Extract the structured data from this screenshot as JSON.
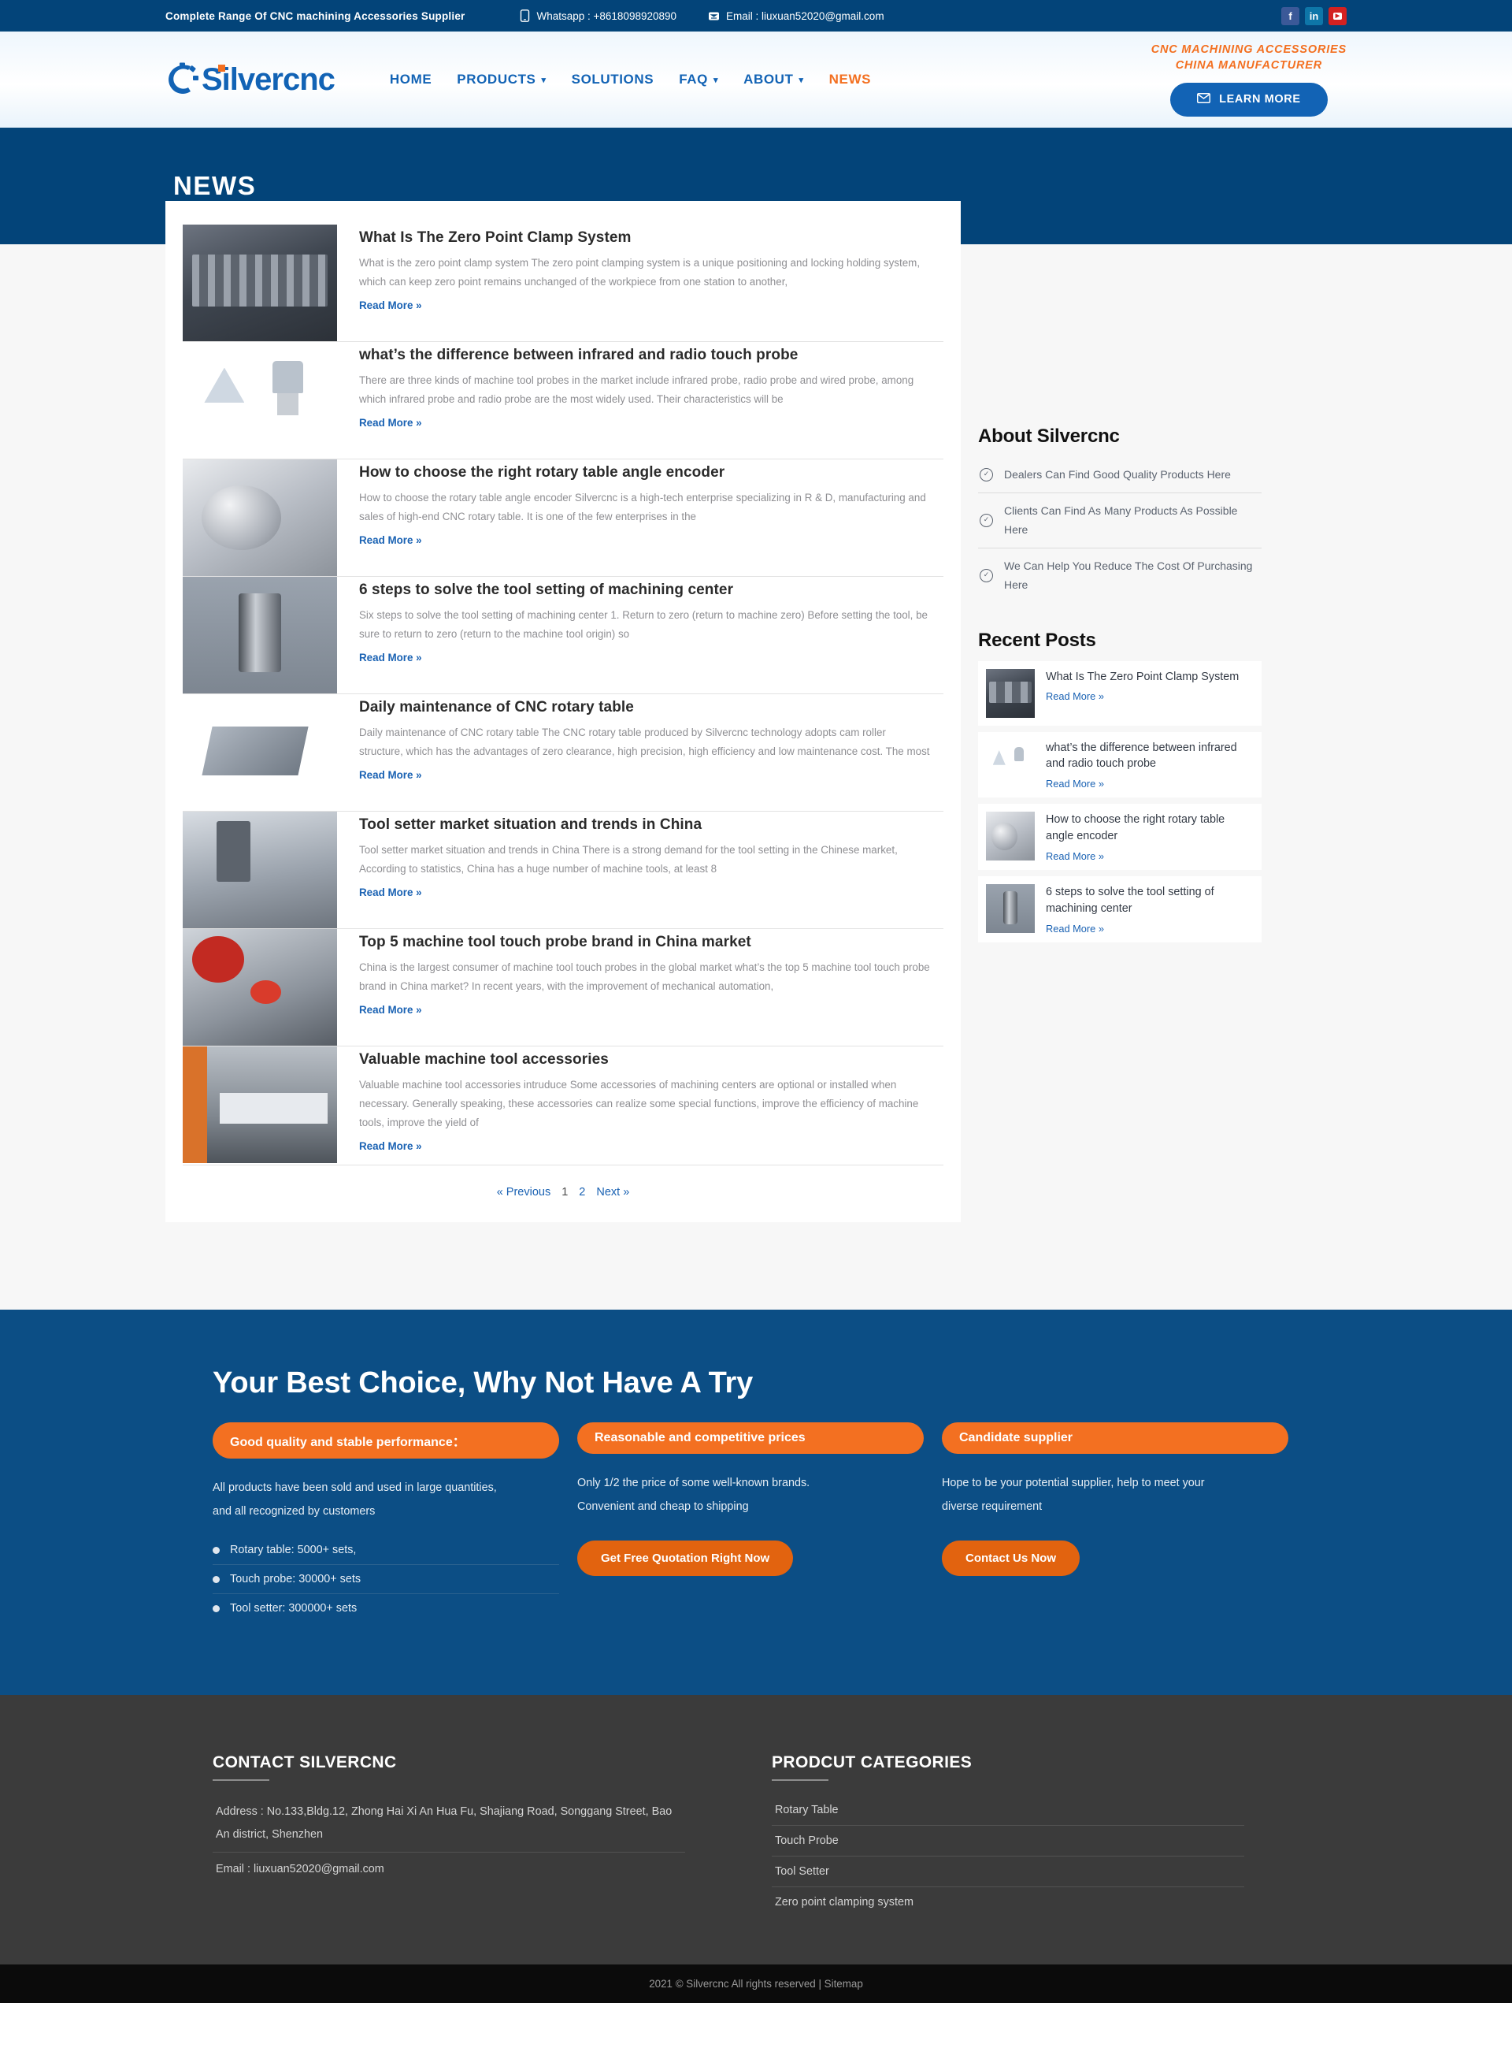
{
  "topbar": {
    "tagline": "Complete Range Of CNC machining Accessories Supplier",
    "whatsapp_icon": "phone-icon",
    "whatsapp_label": "Whatsapp :  +8618098920890",
    "email_icon": "envelope-icon",
    "email_label": "Email :  liuxuan52020@gmail.com",
    "socials": [
      {
        "name": "facebook-icon",
        "glyph": "f"
      },
      {
        "name": "linkedin-icon",
        "glyph": "in"
      },
      {
        "name": "youtube-icon",
        "glyph": "▶"
      }
    ]
  },
  "header": {
    "logo_text": "Silvercnc",
    "nav": [
      {
        "label": "HOME",
        "caret": "",
        "active": false
      },
      {
        "label": "PRODUCTS",
        "caret": "⌄",
        "active": false
      },
      {
        "label": "SOLUTIONS",
        "caret": "",
        "active": false
      },
      {
        "label": "FAQ",
        "caret": "⌄",
        "active": false
      },
      {
        "label": "ABOUT",
        "caret": "⌄",
        "active": false
      },
      {
        "label": "NEWS",
        "caret": "",
        "active": true
      }
    ],
    "tagline_line1": "CNC MACHINING ACCESSORIES",
    "tagline_line2": "CHINA MANUFACTURER",
    "cta_icon": "envelope-icon",
    "cta_label": "LEARN MORE"
  },
  "banner": {
    "title": "NEWS"
  },
  "posts": [
    {
      "title": "What Is The Zero Point Clamp System",
      "excerpt": "What is the zero point clamp system The zero point clamping system is a unique positioning and locking holding system, which can keep zero point remains unchanged of the workpiece from one station to another,",
      "read_more": "Read More »",
      "thumb": "t1"
    },
    {
      "title": "what’s the difference between infrared and radio touch probe",
      "excerpt": "There are three kinds of machine tool probes in the market include infrared probe, radio probe and wired probe, among which infrared probe and radio probe are the most widely used. Their characteristics will be",
      "read_more": "Read More »",
      "thumb": "t2"
    },
    {
      "title": "How to choose the right rotary table angle encoder",
      "excerpt": "How to choose the rotary table angle encoder Silvercnc  is a high-tech enterprise specializing in  R & D, manufacturing and sales of high-end CNC rotary table. It is one of the few enterprises in the",
      "read_more": "Read More »",
      "thumb": "t3"
    },
    {
      "title": "6 steps to solve the tool setting of machining center",
      "excerpt": "Six steps to solve the tool setting of machining center 1. Return to zero (return to machine zero) Before setting the tool, be sure to return to zero (return to the machine tool origin) so",
      "read_more": "Read More »",
      "thumb": "t4"
    },
    {
      "title": "Daily maintenance of CNC rotary table",
      "excerpt": "Daily maintenance of CNC rotary table The CNC rotary table produced by Silvercnc technology adopts cam roller structure, which has the advantages of zero clearance, high precision, high efficiency and low maintenance cost. The most",
      "read_more": "Read More »",
      "thumb": "t5"
    },
    {
      "title": "Tool setter market situation and trends in China",
      "excerpt": "Tool setter market situation and trends in China There is a strong demand for the tool setting  in the Chinese market, According to statistics, China has a huge number of machine tools, at least 8",
      "read_more": "Read More »",
      "thumb": "t6"
    },
    {
      "title": "Top 5 machine tool touch probe brand in China market",
      "excerpt": "China is the largest consumer of machine tool touch probes in the global market what’s the top 5 machine tool touch probe brand in China market? In recent years, with the improvement of mechanical automation,",
      "read_more": "Read More »",
      "thumb": "t7"
    },
    {
      "title": "Valuable machine tool accessories",
      "excerpt": "Valuable machine tool accessories intruduce Some accessories of machining centers are optional or installed when necessary. Generally speaking, these accessories can realize some special functions, improve the efficiency of machine tools, improve the yield of",
      "read_more": "Read More »",
      "thumb": "t8"
    }
  ],
  "pagination": {
    "previous": "« Previous",
    "pages": [
      "1",
      "2"
    ],
    "current": "1",
    "next": "Next »"
  },
  "sidebar": {
    "about_heading": "About Silvercnc",
    "about_items": [
      "Dealers Can Find Good Quality Products Here",
      "Clients Can Find As Many Products As Possible Here",
      "We Can Help You Reduce The Cost Of Purchasing Here"
    ],
    "recent_heading": "Recent Posts",
    "recent_posts": [
      {
        "title": "What Is The Zero Point Clamp System",
        "read_more": "Read More »",
        "thumb": "t1"
      },
      {
        "title": "what’s the difference between infrared and radio touch probe",
        "read_more": "Read More »",
        "thumb": "t2"
      },
      {
        "title": "How to choose the right rotary table angle encoder",
        "read_more": "Read More »",
        "thumb": "t3"
      },
      {
        "title": "6 steps to solve the tool setting of machining center",
        "read_more": "Read More »",
        "thumb": "t4"
      }
    ]
  },
  "cta": {
    "title": "Your Best Choice, Why Not Have A Try",
    "columns": [
      {
        "pill": "Good quality and stable performance：",
        "text1": "All products have been sold and used in large quantities,",
        "text2": "and all recognized by customers",
        "bullets": [
          "Rotary table: 5000+ sets,",
          "Touch probe: 30000+ sets",
          "Tool setter: 300000+ sets"
        ],
        "button": ""
      },
      {
        "pill": "Reasonable and competitive prices",
        "text1": "Only 1/2 the price of some well-known brands.",
        "text2": "Convenient and cheap to shipping",
        "bullets": [],
        "button": "Get Free Quotation Right Now"
      },
      {
        "pill": "Candidate supplier",
        "text1": "Hope to be your potential supplier, help to meet your",
        "text2": "diverse requirement",
        "bullets": [],
        "button": "Contact Us Now"
      }
    ]
  },
  "footer": {
    "contact_heading": "CONTACT SILVERCNC",
    "address": "Address : No.133,Bldg.12, Zhong Hai Xi An Hua Fu, Shajiang Road, Songgang Street, Bao An district, Shenzhen",
    "email": "Email : liuxuan52020@gmail.com",
    "categories_heading": "PRODCUT CATEGORIES",
    "categories": [
      "Rotary Table",
      "Touch Probe",
      "Tool Setter",
      "Zero point clamping system"
    ],
    "copyright": "2021 © Silvercnc All rights reserved | ",
    "sitemap": "Sitemap"
  },
  "colors": {
    "brand_blue": "#034479",
    "nav_blue": "#1263b5",
    "accent_orange": "#f37021",
    "cta_bg": "#0c4e85",
    "footer_bg": "#3b3b3b"
  }
}
